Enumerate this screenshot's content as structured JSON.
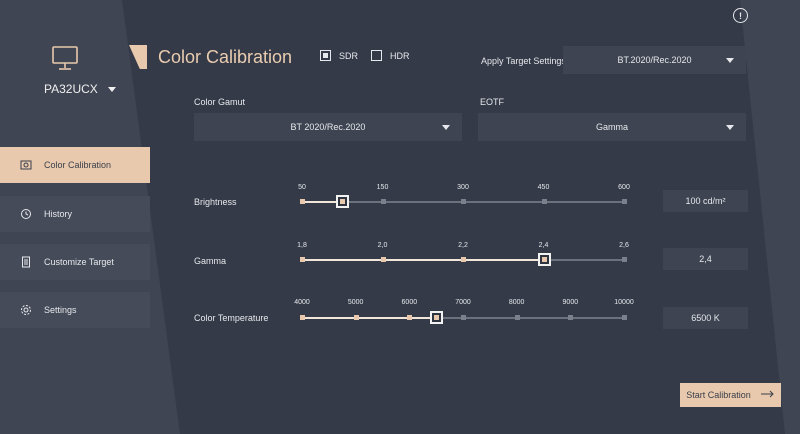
{
  "device": {
    "model": "PA32UCX",
    "icon": "monitor-icon"
  },
  "sidebar": {
    "items": [
      {
        "label": "Color Calibration",
        "icon": "calibration-icon",
        "active": true
      },
      {
        "label": "History",
        "icon": "history-icon",
        "active": false
      },
      {
        "label": "Customize Target",
        "icon": "document-icon",
        "active": false
      },
      {
        "label": "Settings",
        "icon": "gear-icon",
        "active": false
      }
    ]
  },
  "header": {
    "title": "Color Calibration",
    "modes": [
      {
        "label": "SDR",
        "checked": true
      },
      {
        "label": "HDR",
        "checked": false
      }
    ],
    "apply_label": "Apply Target Settings",
    "apply_value": "BT.2020/Rec.2020"
  },
  "gamut": {
    "label": "Color Gamut",
    "value": "BT 2020/Rec.2020"
  },
  "eotf": {
    "label": "EOTF",
    "value": "Gamma"
  },
  "sliders": {
    "brightness": {
      "label": "Brightness",
      "ticks": [
        "50",
        "150",
        "300",
        "450",
        "600"
      ],
      "selected_index": 0.5,
      "value": "100 cd/m²"
    },
    "gamma": {
      "label": "Gamma",
      "ticks": [
        "1,8",
        "2,0",
        "2,2",
        "2,4",
        "2,6"
      ],
      "selected_index": 3,
      "value": "2,4"
    },
    "temperature": {
      "label": "Color Temperature",
      "ticks": [
        "4000",
        "5000",
        "6000",
        "7000",
        "8000",
        "9000",
        "10000"
      ],
      "selected_index": 2.5,
      "value": "6500 K"
    }
  },
  "start_button": {
    "label": "Start Calibration",
    "icon": "arrow-right-icon"
  },
  "colors": {
    "accent": "#e8c9ad",
    "background": "#343a47",
    "panel": "#3e4451"
  }
}
